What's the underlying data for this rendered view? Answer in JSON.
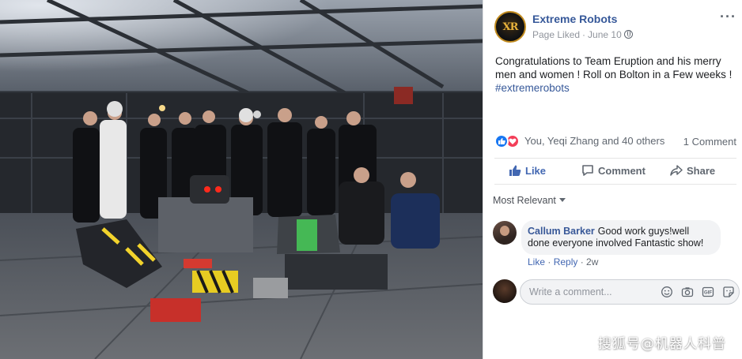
{
  "post": {
    "page_name": "Extreme Robots",
    "status": "Page Liked",
    "date": "June 10",
    "text_line": "Congratulations to Team Eruption and his merry men and women ! Roll on Bolton in a Few weeks !",
    "hashtag": "#extremerobots"
  },
  "reactions": {
    "names": "You, Yeqi Zhang and 40 others",
    "comment_count": "1 Comment"
  },
  "actions": {
    "like": "Like",
    "comment": "Comment",
    "share": "Share"
  },
  "sort": {
    "label": "Most Relevant"
  },
  "comment": {
    "author": "Callum Barker",
    "text": "Good work guys!well done everyone involved Fantastic show!",
    "like": "Like",
    "reply": "Reply",
    "age": "2w"
  },
  "composer": {
    "placeholder": "Write a comment..."
  },
  "watermark": "搜狐号@机器人科普",
  "colors": {
    "link": "#365899",
    "action_active": "#4267b2",
    "like_reaction": "#1877f2",
    "love_reaction": "#f33e58"
  }
}
